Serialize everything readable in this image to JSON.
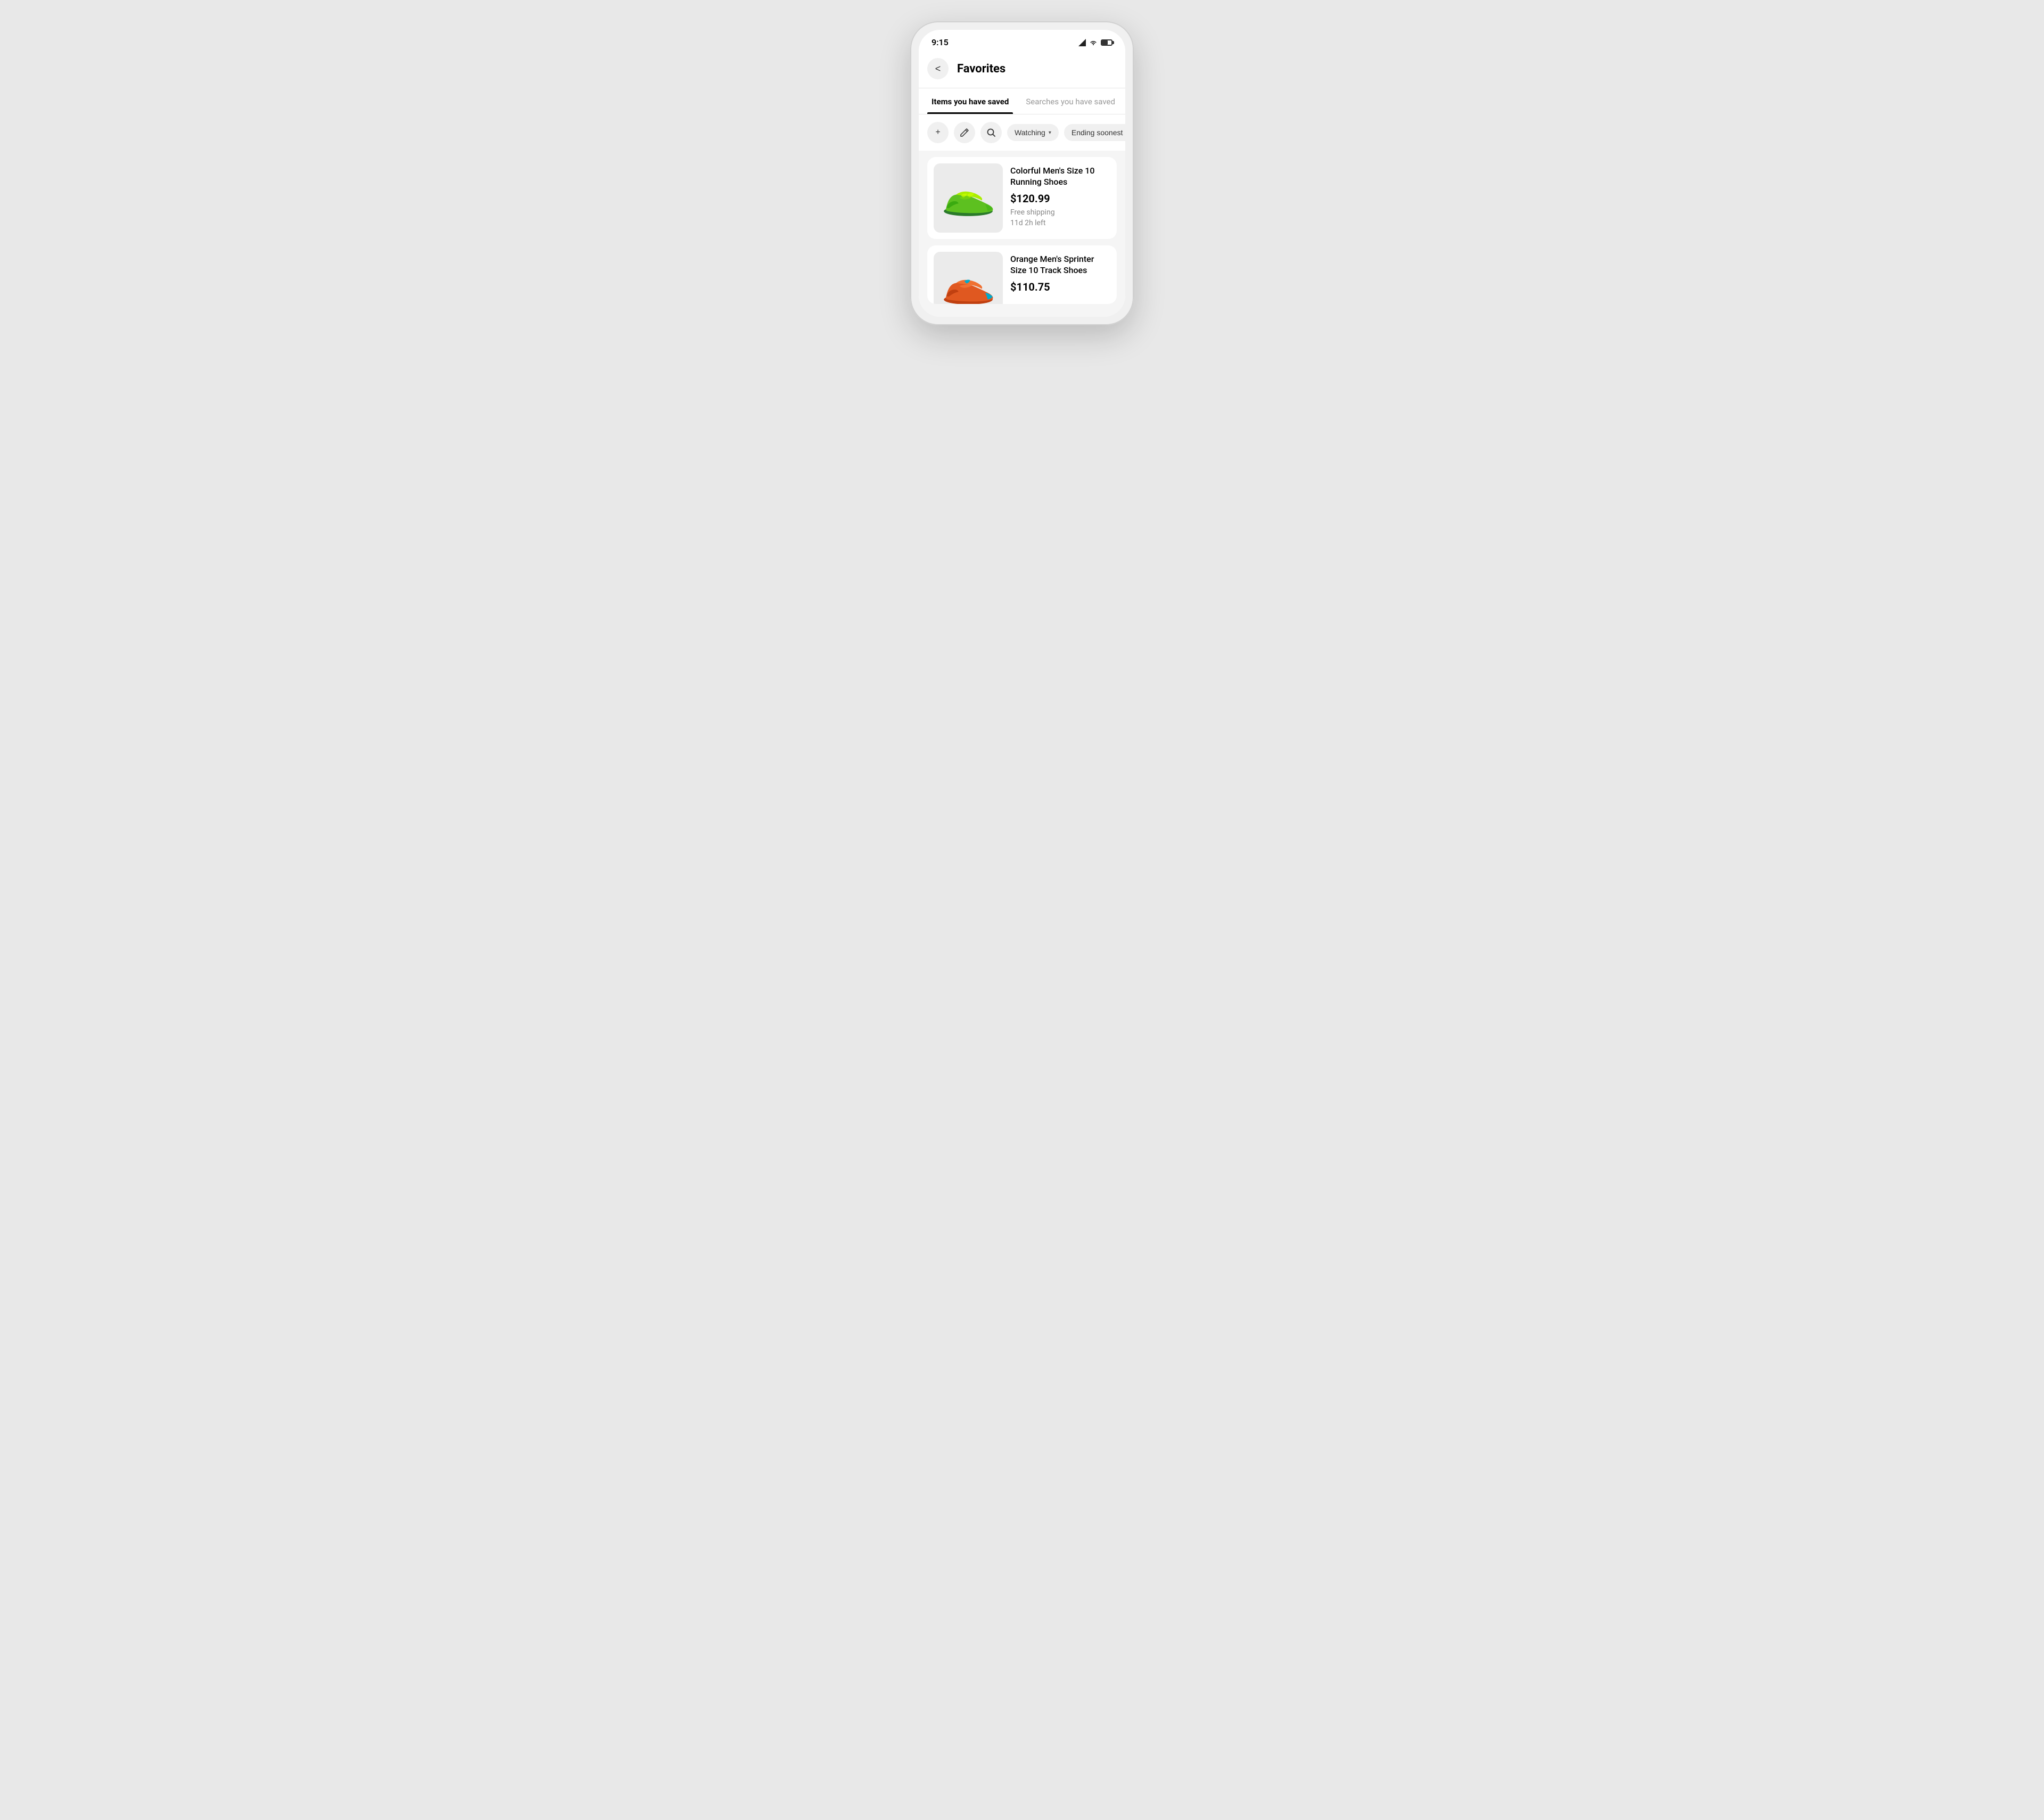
{
  "status_bar": {
    "time": "9:15"
  },
  "header": {
    "back_label": "‹",
    "title": "Favorites"
  },
  "tabs": [
    {
      "id": "saved-items",
      "label": "Items you have saved",
      "active": true
    },
    {
      "id": "saved-searches",
      "label": "Searches you have saved",
      "active": false
    }
  ],
  "filter_bar": {
    "add_label": "+",
    "edit_label": "✎",
    "search_label": "🔍",
    "watching_label": "Watching",
    "sorting_label": "Ending soonest"
  },
  "items": [
    {
      "title": "Colorful Men's Size 10 Running Shoes",
      "price": "$120.99",
      "shipping": "Free shipping",
      "time_left": "11d 2h left"
    },
    {
      "title": "Orange Men's Sprinter Size 10 Track Shoes",
      "price": "$110.75",
      "shipping": "",
      "time_left": ""
    }
  ]
}
